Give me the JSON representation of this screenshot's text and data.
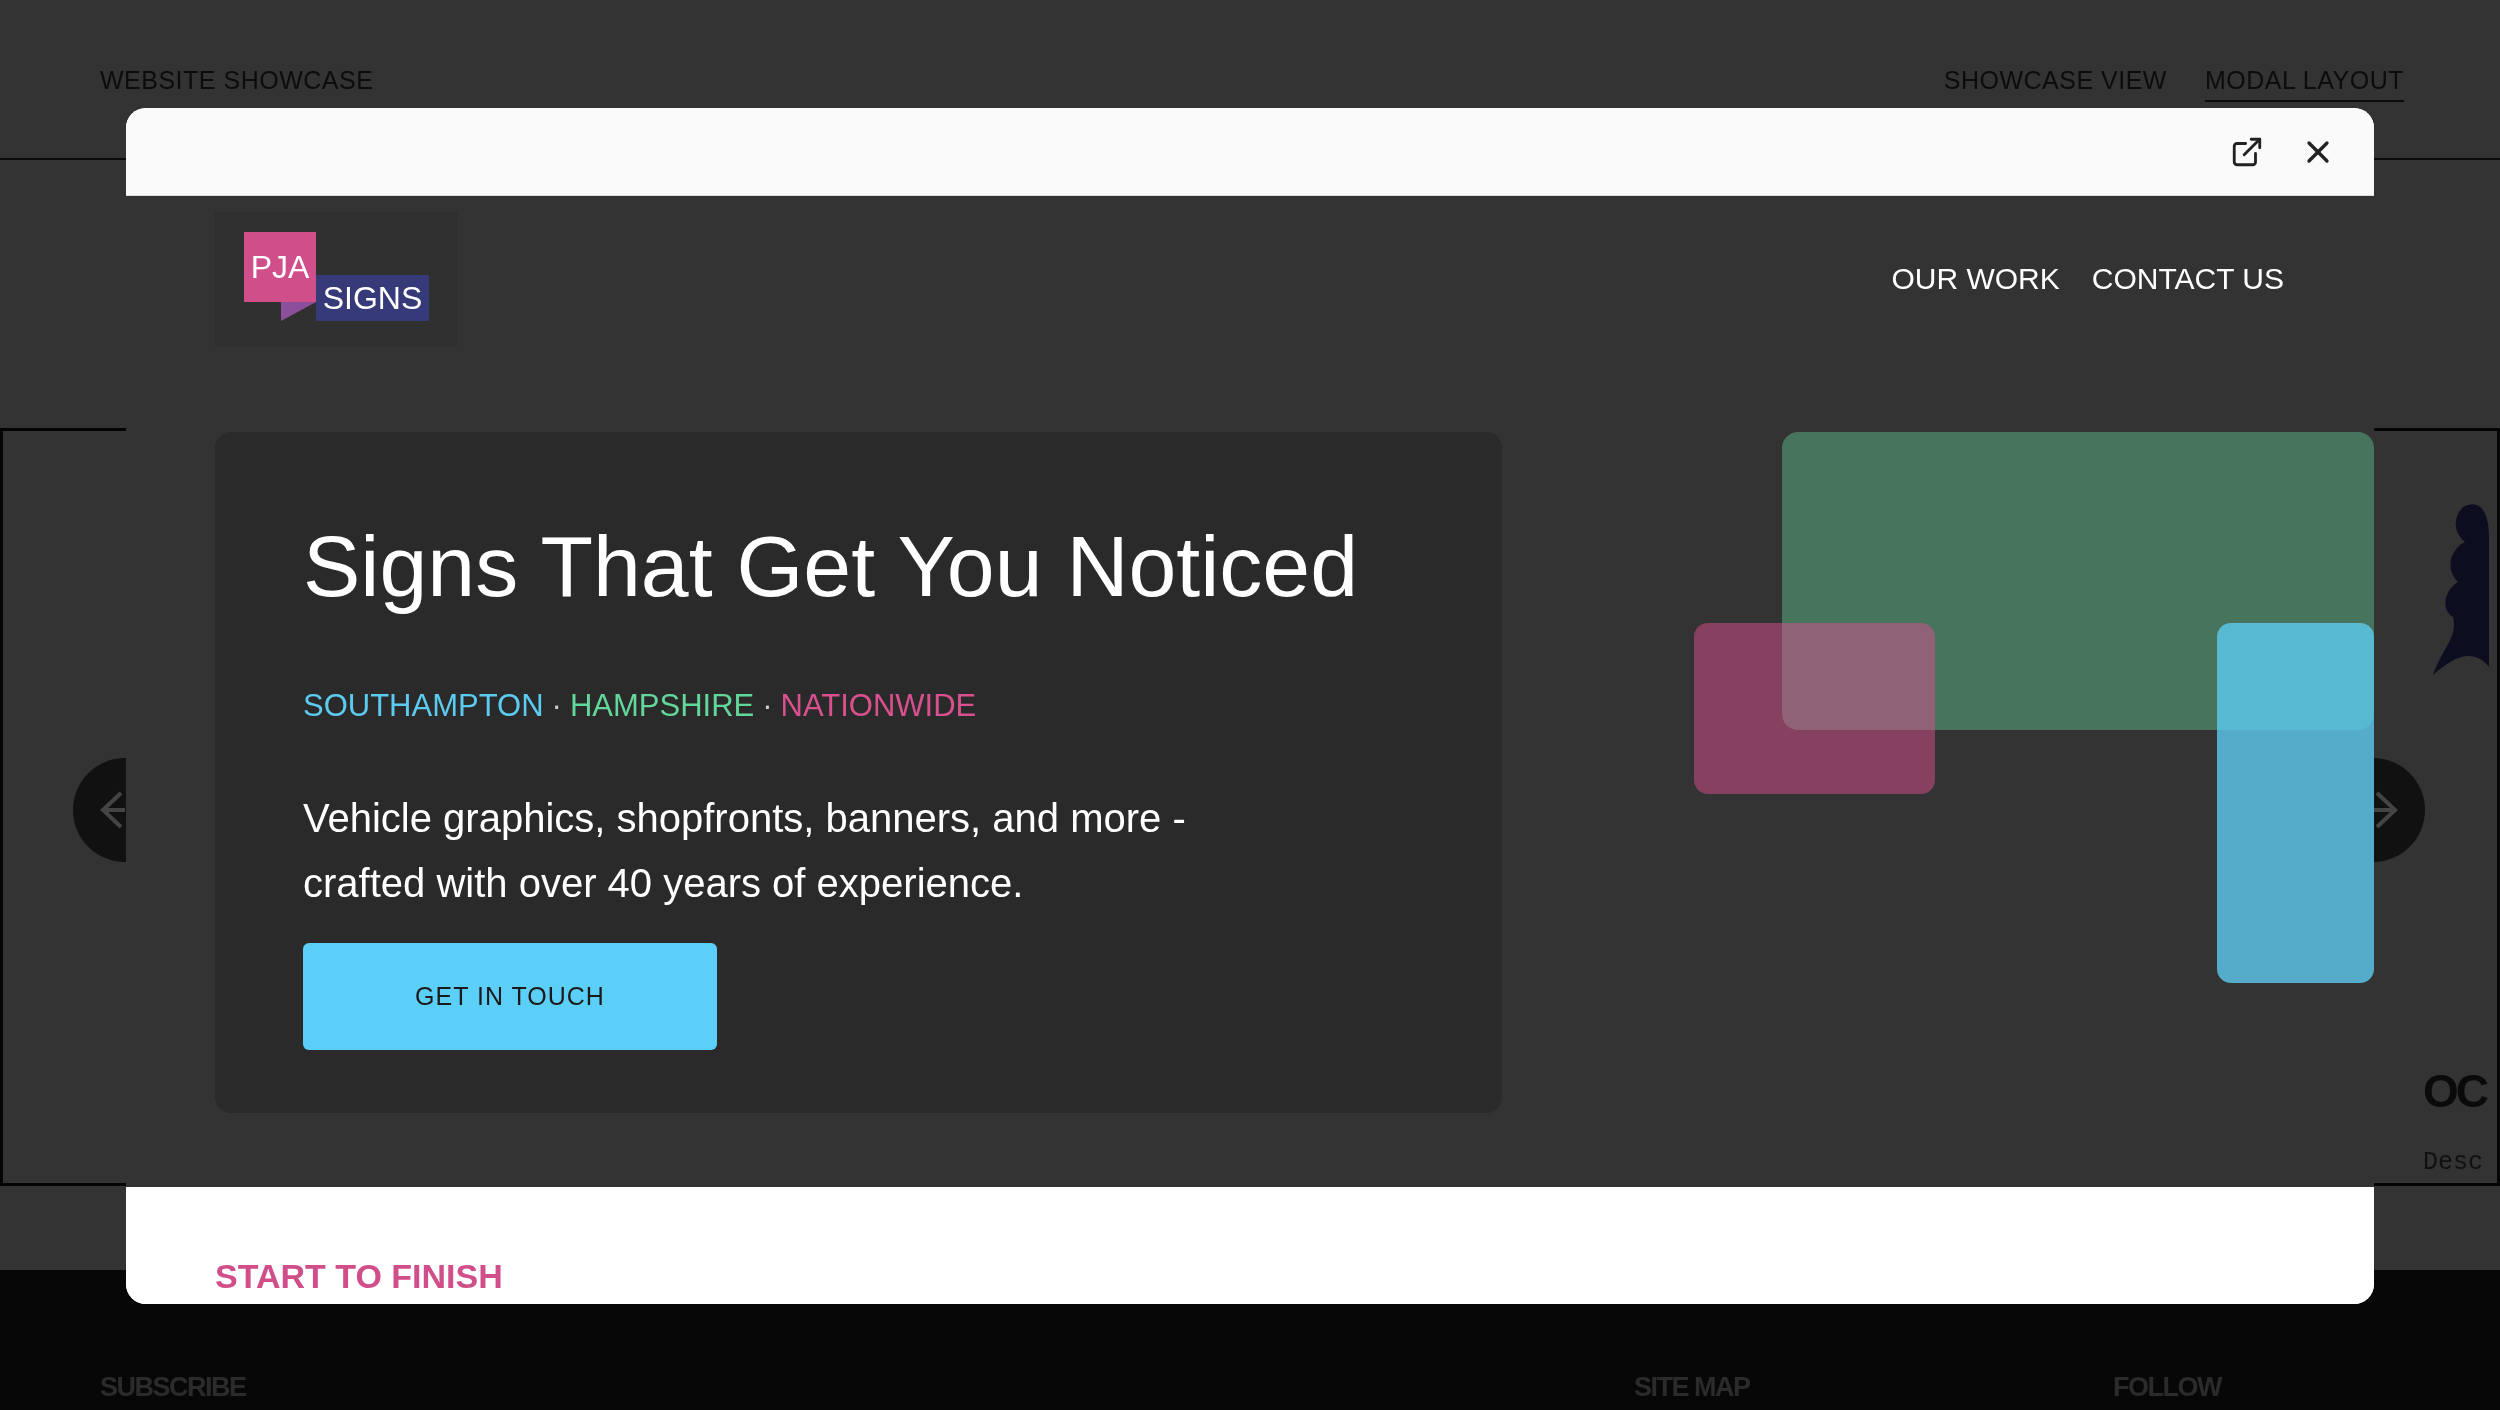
{
  "page": {
    "brand": "WEBSITE SHOWCASE",
    "view_tabs": [
      {
        "label": "SHOWCASE VIEW",
        "selected": false
      },
      {
        "label": "MODAL LAYOUT",
        "selected": true
      }
    ]
  },
  "carousel": {
    "cards": [
      {
        "title": "OC",
        "description": "Desc"
      }
    ]
  },
  "modal": {
    "site": {
      "logo": {
        "top": "PJA",
        "bottom": "SIGNS"
      },
      "nav": [
        "OUR WORK",
        "CONTACT US"
      ],
      "hero": {
        "title": "Signs That Get You Noticed",
        "separator": "·",
        "locations": [
          {
            "label": "SOUTHAMPTON",
            "color": "#5ccbf0"
          },
          {
            "label": "HAMPSHIRE",
            "color": "#63d69a"
          },
          {
            "label": "NATIONWIDE",
            "color": "#d9508e"
          }
        ],
        "description": "Vehicle graphics, shopfronts, banners, and more - crafted with over 40 years of experience.",
        "button": "GET IN TOUCH"
      },
      "section_heading": "START TO FINISH"
    }
  },
  "footer": {
    "headings": [
      "SUBSCRIBE",
      "SITE MAP",
      "FOLLOW"
    ]
  }
}
